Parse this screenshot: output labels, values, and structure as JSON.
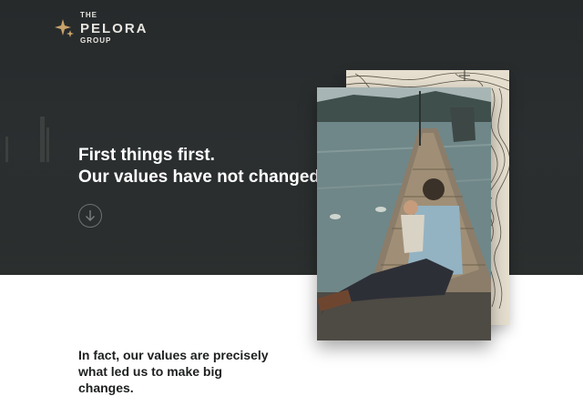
{
  "logo": {
    "line1": "THE",
    "line2": "PELORA",
    "line3": "GROUP",
    "accent": "#c9a36a"
  },
  "hero": {
    "headline_line1": "First things first.",
    "headline_line2": "Our values have not changed.",
    "scroll_icon": "arrow-down-circle-icon"
  },
  "intro": {
    "text": "In fact, our values are precisely what led us to make big changes."
  },
  "colors": {
    "hero_bg": "#262a2b",
    "page_bg": "#ffffff",
    "text_light": "#ffffff",
    "text_dark": "#1d1f20"
  }
}
